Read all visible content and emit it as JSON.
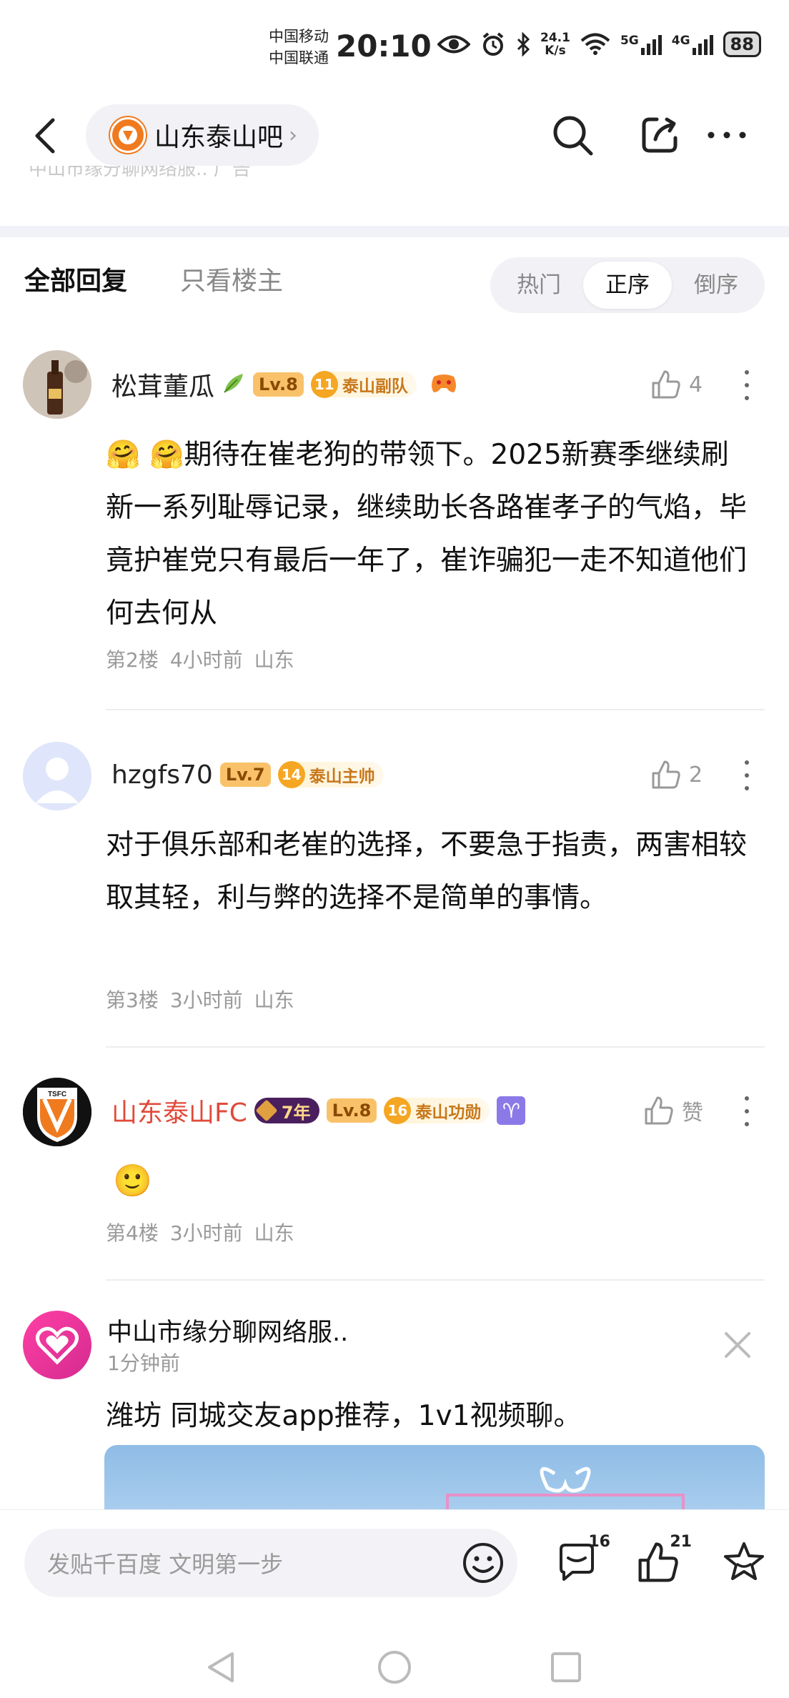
{
  "status_bar": {
    "carrier_1": "中国移动",
    "carrier_2": "中国联通",
    "time": "20:10",
    "net_speed_value": "24.1",
    "net_speed_unit": "K/s",
    "net_5g": "5G",
    "net_4g": "4G",
    "battery": "88"
  },
  "nav": {
    "forum_name": "山东泰山吧",
    "faded_text": "中山市缘分聊网络服.. 广告"
  },
  "filter": {
    "tab_all": "全部回复",
    "tab_owner": "只看楼主",
    "sort_options": [
      "热门",
      "正序",
      "倒序"
    ],
    "sort_active": "正序"
  },
  "replies": [
    {
      "username": "松茸董瓜",
      "level": "Lv.8",
      "honor_num": "11",
      "honor_label": "泰山副队",
      "likes": "4",
      "text": "🤗 🤗期待在崔老狗的带领下。2025新赛季继续刷新一系列耻辱记录，继续助长各路崔孝子的气焰，毕竟护崔党只有最后一年了，崔诈骗犯一走不知道他们何去何从",
      "floor": "第2楼",
      "time": "4小时前",
      "location": "山东"
    },
    {
      "username": "hzgfs70",
      "level": "Lv.7",
      "honor_num": "14",
      "honor_label": "泰山主帅",
      "likes": "2",
      "text": "对于俱乐部和老崔的选择，不要急于指责，两害相较取其轻，利与弊的选择不是简单的事情。",
      "floor": "第3楼",
      "time": "3小时前",
      "location": "山东"
    },
    {
      "username": "山东泰山FC",
      "years": "7年",
      "level": "Lv.8",
      "honor_num": "16",
      "honor_label": "泰山功勋",
      "zodiac": "♈",
      "likes": "赞",
      "text": "🙂",
      "floor": "第4楼",
      "time": "3小时前",
      "location": "山东"
    }
  ],
  "ad": {
    "title": "中山市缘分聊网络服..",
    "time": "1分钟前",
    "text": "潍坊 同城交友app推荐，1v1视频聊。"
  },
  "bottom_bar": {
    "input_placeholder": "发贴千百度 文明第一步",
    "comment_count": "16",
    "like_count": "21"
  },
  "colors": {
    "accent_red": "#e04a3a",
    "honor_orange": "#f5a623",
    "level_bg": "#f9c26a"
  }
}
